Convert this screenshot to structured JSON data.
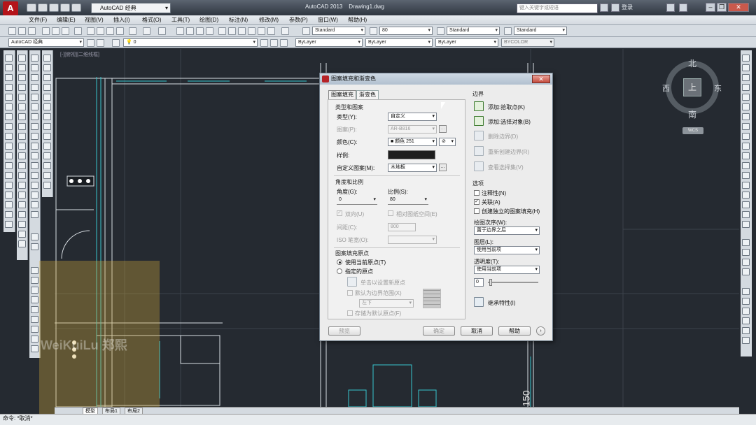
{
  "titlebar": {
    "workspace": "AutoCAD 经典",
    "app_title": "AutoCAD 2013",
    "drawing_title": "Drawing1.dwg",
    "search_placeholder": "键入关键字或短语",
    "login": "登录",
    "logo_letter": "A"
  },
  "menubar": [
    "文件(F)",
    "编辑(E)",
    "视图(V)",
    "插入(I)",
    "格式(O)",
    "工具(T)",
    "绘图(D)",
    "标注(N)",
    "修改(M)",
    "参数(P)",
    "窗口(W)",
    "帮助(H)"
  ],
  "toolbar1": {
    "text_style": "Standard",
    "dim_scale": "80",
    "dim_style": "Standard",
    "table_style": "Standard"
  },
  "toolbar2": {
    "workspace": "AutoCAD 经典",
    "layer": "0",
    "color": "ByLayer",
    "linetype": "ByLayer",
    "lineweight": "ByLayer",
    "plotstyle": "BYCOLOR"
  },
  "compass": {
    "north": "北",
    "south": "南",
    "west": "西",
    "east": "东",
    "top": "上",
    "wcs": "WCS"
  },
  "canvas": {
    "viewport_label": "[-][俯视][二维线框]",
    "dimension_text": "150"
  },
  "watermark": "WeiKuiLu 郑熙",
  "tabs": [
    "模型",
    "布局1",
    "布局2"
  ],
  "command_line": "命令: *取消*",
  "dialog": {
    "title": "图案填充和渐变色",
    "tab_hatch": "图案填充",
    "tab_gradient": "渐变色",
    "type_group": "类型和图案",
    "type_label": "类型(Y):",
    "type_value": "自定义",
    "pattern_label": "图案(P):",
    "pattern_value": "AR-B816",
    "color_label": "颜色(C):",
    "color_value": "颜色 251",
    "sample_label": "样例:",
    "custom_label": "自定义图案(M):",
    "custom_value": "木地板",
    "angle_group": "角度和比例",
    "angle_label": "角度(G):",
    "angle_value": "0",
    "scale_label": "比例(S):",
    "scale_value": "80",
    "double_label": "双向(U)",
    "relative_label": "相对图纸空间(E)",
    "spacing_label": "间距(C):",
    "spacing_value": "800",
    "iso_label": "ISO 笔宽(O):",
    "origin_group": "图案填充原点",
    "origin_current": "使用当前原点(T)",
    "origin_specified": "指定的原点",
    "origin_click": "单击以设置新原点",
    "origin_default_extent": "默认为边界范围(X)",
    "origin_position": "左下",
    "origin_store": "存储为默认原点(F)",
    "boundary_group": "边界",
    "add_pick": "添加:拾取点(K)",
    "add_select": "添加:选择对象(B)",
    "remove_boundary": "删除边界(D)",
    "recreate_boundary": "重新创建边界(R)",
    "view_selection": "查看选择集(V)",
    "options_group": "选项",
    "annotative": "注释性(N)",
    "associative": "关联(A)",
    "separate": "创建独立的图案填充(H)",
    "draw_order_label": "绘图次序(W):",
    "draw_order_value": "置于边界之后",
    "layer_label": "图层(L):",
    "layer_value": "使用当前项",
    "transparency_label": "透明度(T):",
    "transparency_value": "使用当前项",
    "transparency_number": "0",
    "inherit": "继承特性(I)",
    "btn_preview": "预览",
    "btn_ok": "确定",
    "btn_cancel": "取消",
    "btn_help": "帮助",
    "annotative_checked": false,
    "associative_checked": true,
    "separate_checked": false
  }
}
